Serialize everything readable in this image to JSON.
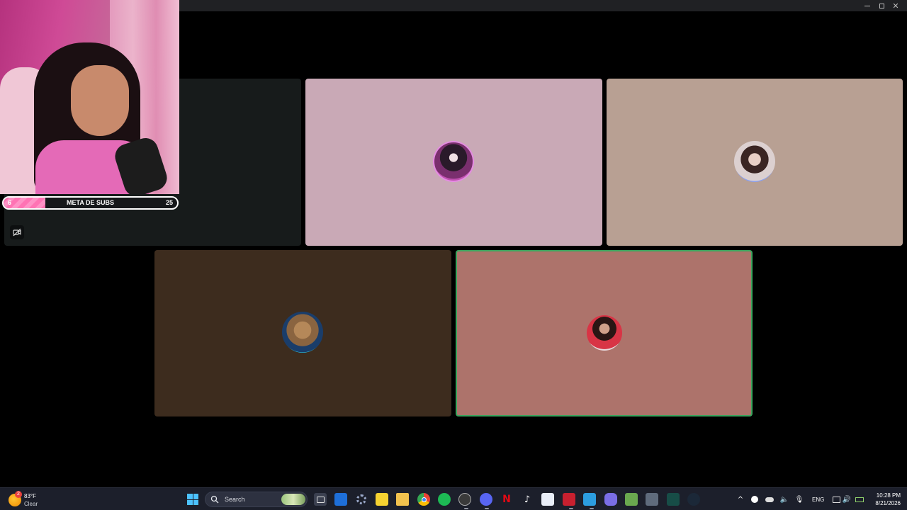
{
  "window": {
    "controls": [
      "minimize",
      "maximize",
      "close"
    ]
  },
  "stream_overlay": {
    "sub_goal": {
      "label": "META DE SUBS",
      "current": "6",
      "target": "25",
      "progress_fraction": 0.24
    }
  },
  "participants": [
    {
      "tile": "own-camera-tile",
      "muted": true,
      "avatar": "webcam-hidden"
    },
    {
      "tile": "participant-1",
      "color": "#c9a9b6",
      "avatar": "girl-headphones-avatar"
    },
    {
      "tile": "participant-2",
      "color": "#b8a093",
      "avatar": "girl-selfie-avatar"
    },
    {
      "tile": "participant-3",
      "color": "#3d2c1e",
      "avatar": "teddy-bear-avatar"
    },
    {
      "tile": "participant-4",
      "color": "#ad736b",
      "avatar": "woman-red-top-avatar",
      "speaking": true
    }
  ],
  "taskbar": {
    "weather": {
      "temp": "83°F",
      "condition": "Clear",
      "badge": "2"
    },
    "search_placeholder": "Search",
    "pinned_apps": [
      "start",
      "search",
      "task-view",
      "store",
      "settings",
      "sticky-notes",
      "file-explorer",
      "chrome",
      "spotify",
      "obs",
      "discord",
      "netflix",
      "tiktok",
      "snipping-tool",
      "voicemod",
      "photos",
      "gamepad",
      "minecraft",
      "calculator",
      "terminal",
      "steam"
    ],
    "tray": {
      "language": "ENG",
      "time": "10:28 PM",
      "date": "8/21/2026"
    }
  },
  "colors": {
    "speaking_border": "#3ba55d",
    "taskbar_bg": "#1c1f2b",
    "accent": "#ff73b4"
  }
}
